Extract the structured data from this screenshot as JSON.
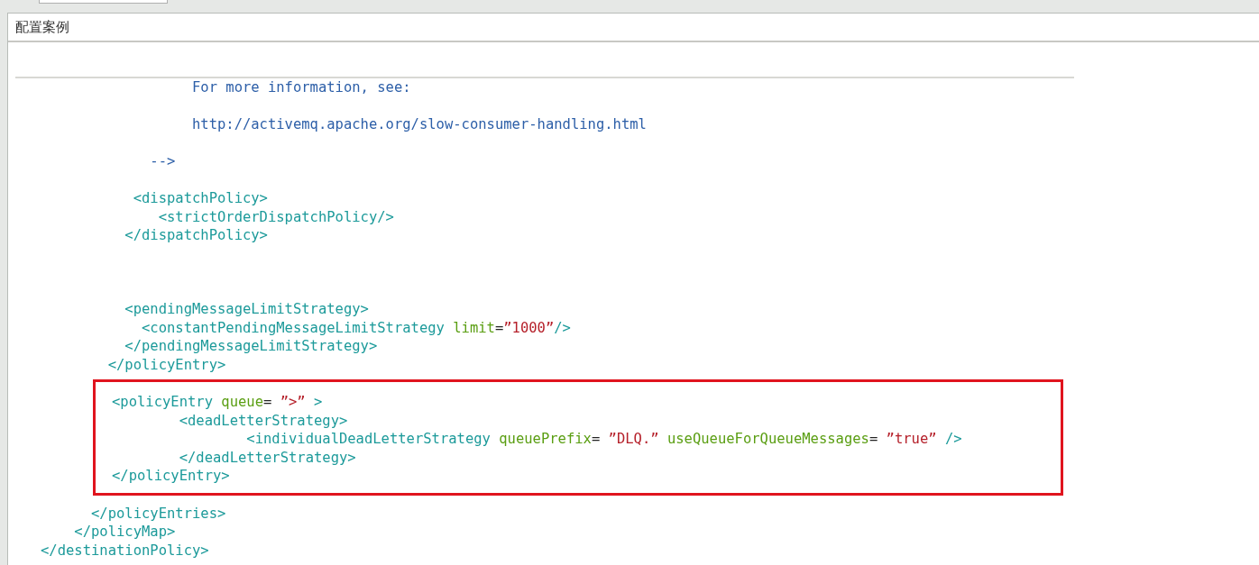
{
  "panel": {
    "title": "配置案例"
  },
  "code_before": [
    {
      "kind": "code",
      "tokens": [
        {
          "kind": "comment",
          "text": "                     For more information, see:"
        }
      ]
    },
    {
      "kind": "blank"
    },
    {
      "kind": "code",
      "tokens": [
        {
          "kind": "comment",
          "text": "                     http://activemq.apache.org/slow-consumer-handling.html"
        }
      ]
    },
    {
      "kind": "blank"
    },
    {
      "kind": "code",
      "tokens": [
        {
          "kind": "comment",
          "text": "                -->"
        }
      ]
    },
    {
      "kind": "blank"
    },
    {
      "kind": "code",
      "tokens": [
        {
          "kind": "tag",
          "text": "              <dispatchPolicy>"
        }
      ]
    },
    {
      "kind": "code",
      "tokens": [
        {
          "kind": "tag",
          "text": "                 <strictOrderDispatchPolicy/>"
        }
      ]
    },
    {
      "kind": "code",
      "tokens": [
        {
          "kind": "tag",
          "text": "             </dispatchPolicy>"
        }
      ]
    },
    {
      "kind": "blank"
    },
    {
      "kind": "blank"
    },
    {
      "kind": "blank"
    },
    {
      "kind": "code",
      "tokens": [
        {
          "kind": "tag",
          "text": "             <pendingMessageLimitStrategy>"
        }
      ]
    },
    {
      "kind": "code",
      "tokens": [
        {
          "kind": "tag",
          "text": "               <constantPendingMessageLimitStrategy "
        },
        {
          "kind": "attr",
          "text": "limit"
        },
        {
          "kind": "punct",
          "text": "="
        },
        {
          "kind": "string",
          "text": "”1000”"
        },
        {
          "kind": "tag",
          "text": "/>"
        }
      ]
    },
    {
      "kind": "code",
      "tokens": [
        {
          "kind": "tag",
          "text": "             </pendingMessageLimitStrategy>"
        }
      ]
    },
    {
      "kind": "code",
      "tokens": [
        {
          "kind": "tag",
          "text": "           </policyEntry>"
        }
      ]
    }
  ],
  "highlighted": [
    {
      "kind": "code",
      "tokens": [
        {
          "kind": "tag",
          "text": "<policyEntry "
        },
        {
          "kind": "attr",
          "text": "queue"
        },
        {
          "kind": "punct",
          "text": "= "
        },
        {
          "kind": "string",
          "text": "”>”"
        },
        {
          "kind": "tag",
          "text": " >"
        }
      ]
    },
    {
      "kind": "code",
      "tokens": [
        {
          "kind": "tag",
          "text": "        <deadLetterStrategy>"
        }
      ]
    },
    {
      "kind": "code",
      "tokens": [
        {
          "kind": "tag",
          "text": "                <individualDeadLetterStrategy "
        },
        {
          "kind": "attr",
          "text": "queuePrefix"
        },
        {
          "kind": "punct",
          "text": "= "
        },
        {
          "kind": "string",
          "text": "”DLQ.”"
        },
        {
          "kind": "attr",
          "text": " useQueueForQueueMessages"
        },
        {
          "kind": "punct",
          "text": "= "
        },
        {
          "kind": "string",
          "text": "”true”"
        },
        {
          "kind": "tag",
          "text": " />"
        }
      ]
    },
    {
      "kind": "code",
      "tokens": [
        {
          "kind": "tag",
          "text": "        </deadLetterStrategy>"
        }
      ]
    },
    {
      "kind": "code",
      "tokens": [
        {
          "kind": "tag",
          "text": "</policyEntry>"
        }
      ]
    }
  ],
  "code_after": [
    {
      "kind": "code",
      "tokens": [
        {
          "kind": "tag",
          "text": "         </policyEntries>"
        }
      ]
    },
    {
      "kind": "code",
      "tokens": [
        {
          "kind": "tag",
          "text": "       </policyMap>"
        }
      ]
    },
    {
      "kind": "code",
      "tokens": [
        {
          "kind": "tag",
          "text": "   </destinationPolicy>"
        }
      ]
    }
  ]
}
